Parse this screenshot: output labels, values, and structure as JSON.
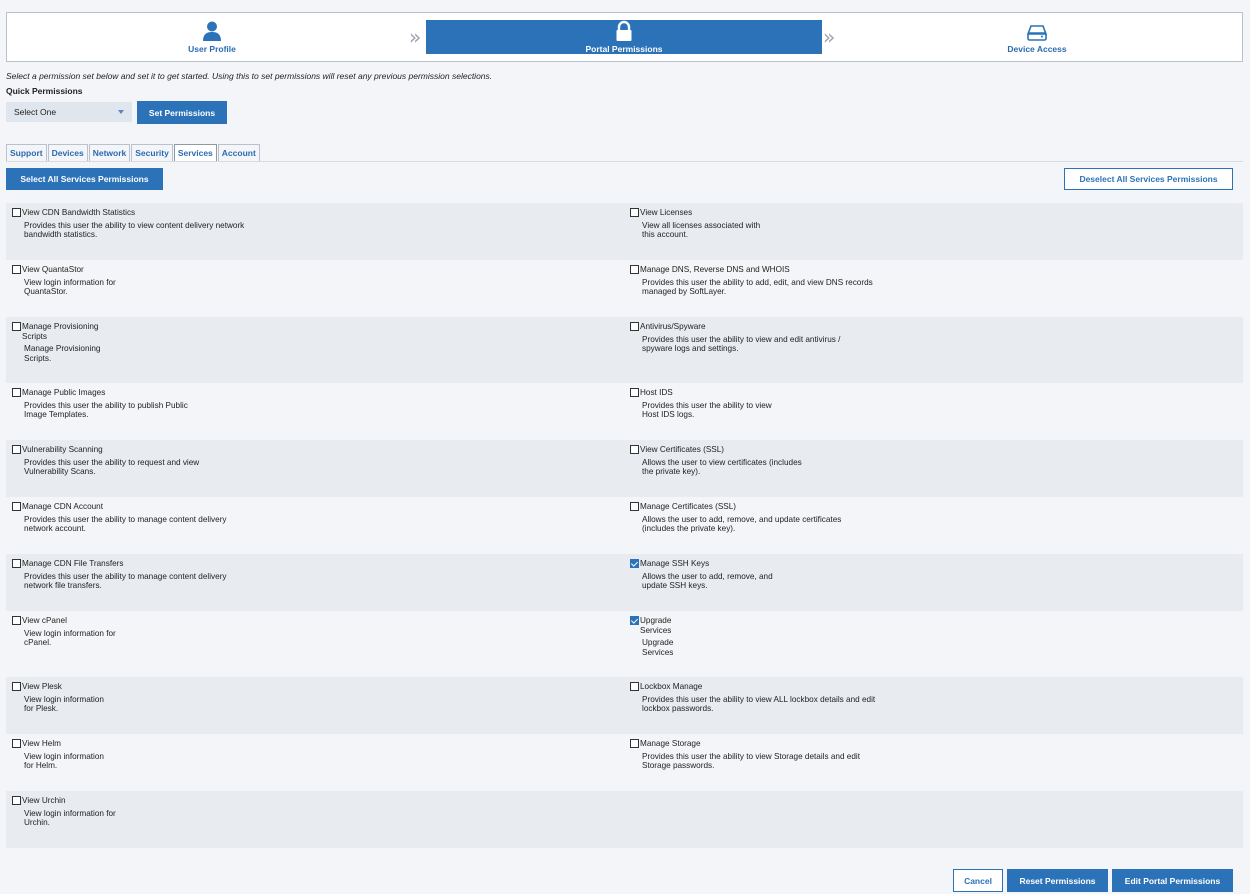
{
  "stepper": {
    "steps": [
      {
        "label": "User Profile",
        "icon": "user-icon"
      },
      {
        "label": "Portal Permissions",
        "icon": "lock-icon",
        "active": true
      },
      {
        "label": "Device Access",
        "icon": "hard-drive-icon"
      }
    ],
    "separator": "»"
  },
  "intro_text": "Select a permission set below and set it to get started. Using this to set permissions will reset any previous permission selections.",
  "quick_permissions": {
    "label": "Quick Permissions",
    "select_value": "Select One",
    "set_button": "Set Permissions"
  },
  "tabs": [
    "Support",
    "Devices",
    "Network",
    "Security",
    "Services",
    "Account"
  ],
  "active_tab": "Services",
  "select_all_button": "Select All Services Permissions",
  "deselect_all_button": "Deselect All Services Permissions",
  "permissions": {
    "rows": [
      {
        "left": {
          "title": "View CDN Bandwidth Statistics",
          "desc": "Provides this user the ability to view content delivery network\nbandwidth statistics.",
          "checked": false
        },
        "right": {
          "title": "View Licenses",
          "desc": "View all licenses associated with\nthis account.",
          "checked": false
        }
      },
      {
        "left": {
          "title": "View QuantaStor",
          "desc": "View login information for\nQuantaStor.",
          "checked": false
        },
        "right": {
          "title": "Manage DNS, Reverse DNS and WHOIS",
          "desc": "Provides this user the ability to add, edit, and view DNS records\nmanaged by SoftLayer.",
          "checked": false
        }
      },
      {
        "left": {
          "title": "Manage Provisioning\nScripts",
          "desc": "Manage Provisioning\nScripts.",
          "checked": false
        },
        "right": {
          "title": "Antivirus/Spyware",
          "desc": "Provides this user the ability to view and edit antivirus /\nspyware logs and settings.",
          "checked": false
        }
      },
      {
        "left": {
          "title": "Manage Public Images",
          "desc": "Provides this user the ability to publish Public\nImage Templates.",
          "checked": false
        },
        "right": {
          "title": "Host IDS",
          "desc": "Provides this user the ability to view\nHost IDS logs.",
          "checked": false
        }
      },
      {
        "left": {
          "title": "Vulnerability Scanning",
          "desc": "Provides this user the ability to request and view\nVulnerability Scans.",
          "checked": false
        },
        "right": {
          "title": "View Certificates (SSL)",
          "desc": "Allows the user to view certificates (includes\nthe private key).",
          "checked": false
        }
      },
      {
        "left": {
          "title": "Manage CDN Account",
          "desc": "Provides this user the ability to manage content delivery\nnetwork account.",
          "checked": false
        },
        "right": {
          "title": "Manage Certificates (SSL)",
          "desc": "Allows the user to add, remove, and update certificates\n(includes the private key).",
          "checked": false
        }
      },
      {
        "left": {
          "title": "Manage CDN File Transfers",
          "desc": "Provides this user the ability to manage content delivery\nnetwork file transfers.",
          "checked": false
        },
        "right": {
          "title": "Manage SSH Keys",
          "desc": "Allows the user to add, remove, and\nupdate SSH keys.",
          "checked": true
        }
      },
      {
        "left": {
          "title": "View cPanel",
          "desc": "View login information for\ncPanel.",
          "checked": false
        },
        "right": {
          "title": "Upgrade\nServices",
          "desc": "Upgrade\nServices",
          "checked": true
        }
      },
      {
        "left": {
          "title": "View Plesk",
          "desc": "View login information\nfor Plesk.",
          "checked": false
        },
        "right": {
          "title": "Lockbox Manage",
          "desc": "Provides this user the ability to view ALL lockbox details and edit\nlockbox passwords.",
          "checked": false
        }
      },
      {
        "left": {
          "title": "View Helm",
          "desc": "View login information\nfor Helm.",
          "checked": false
        },
        "right": {
          "title": "Manage Storage",
          "desc": "Provides this user the ability to view Storage details and edit\nStorage passwords.",
          "checked": false
        }
      },
      {
        "left": {
          "title": "View Urchin",
          "desc": "View login information for\nUrchin.",
          "checked": false
        },
        "right": null
      }
    ]
  },
  "footer": {
    "cancel": "Cancel",
    "reset": "Reset Permissions",
    "edit": "Edit Portal Permissions"
  },
  "colors": {
    "accent": "#2c72b8",
    "row_shade": "#e8ecf0",
    "background": "#f3f5f8"
  }
}
